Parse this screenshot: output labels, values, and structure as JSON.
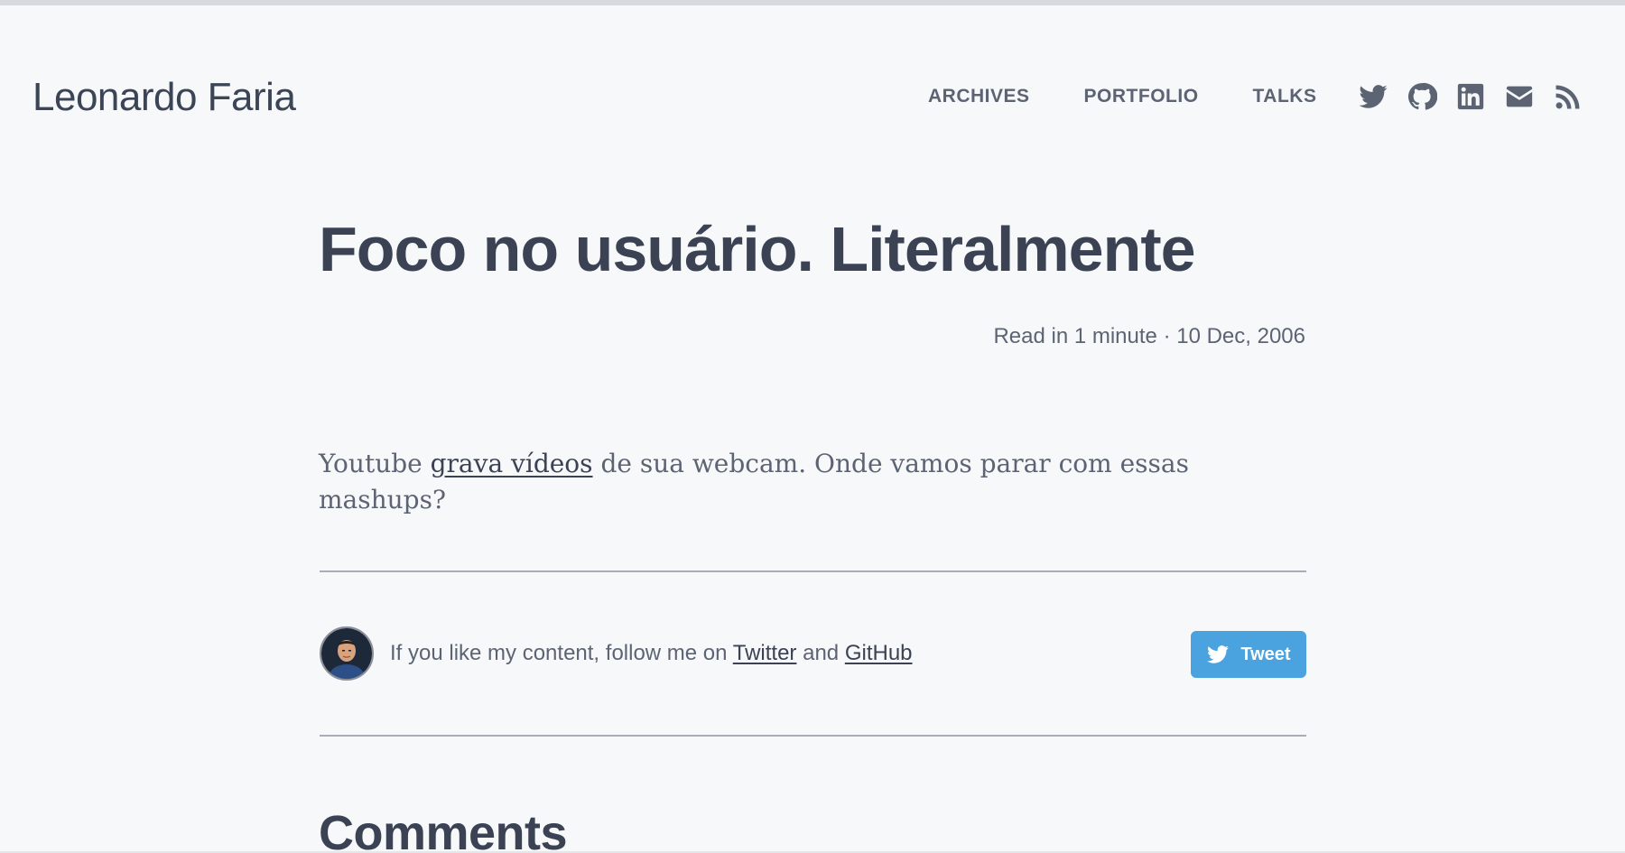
{
  "site": {
    "title": "Leonardo Faria"
  },
  "nav": {
    "items": [
      {
        "label": "ARCHIVES"
      },
      {
        "label": "PORTFOLIO"
      },
      {
        "label": "TALKS"
      }
    ]
  },
  "social": {
    "icons": [
      "twitter-icon",
      "github-icon",
      "linkedin-icon",
      "email-icon",
      "rss-icon"
    ]
  },
  "post": {
    "title": "Foco no usuário. Literalmente",
    "meta": "Read in 1 minute · 10 Dec, 2006",
    "body_before": "Youtube ",
    "body_link": "grava vídeos",
    "body_after": " de sua webcam. Onde vamos parar com essas mashups?"
  },
  "follow": {
    "text_before": "If you like my content, follow me on ",
    "twitter_link": "Twitter",
    "text_middle": " and ",
    "github_link": "GitHub",
    "tweet_label": "Tweet"
  },
  "comments": {
    "title": "Comments"
  },
  "colors": {
    "background": "#f7f8fa",
    "text": "#3a4254",
    "muted": "#5c6474",
    "tweet_button": "#4aa3df"
  }
}
